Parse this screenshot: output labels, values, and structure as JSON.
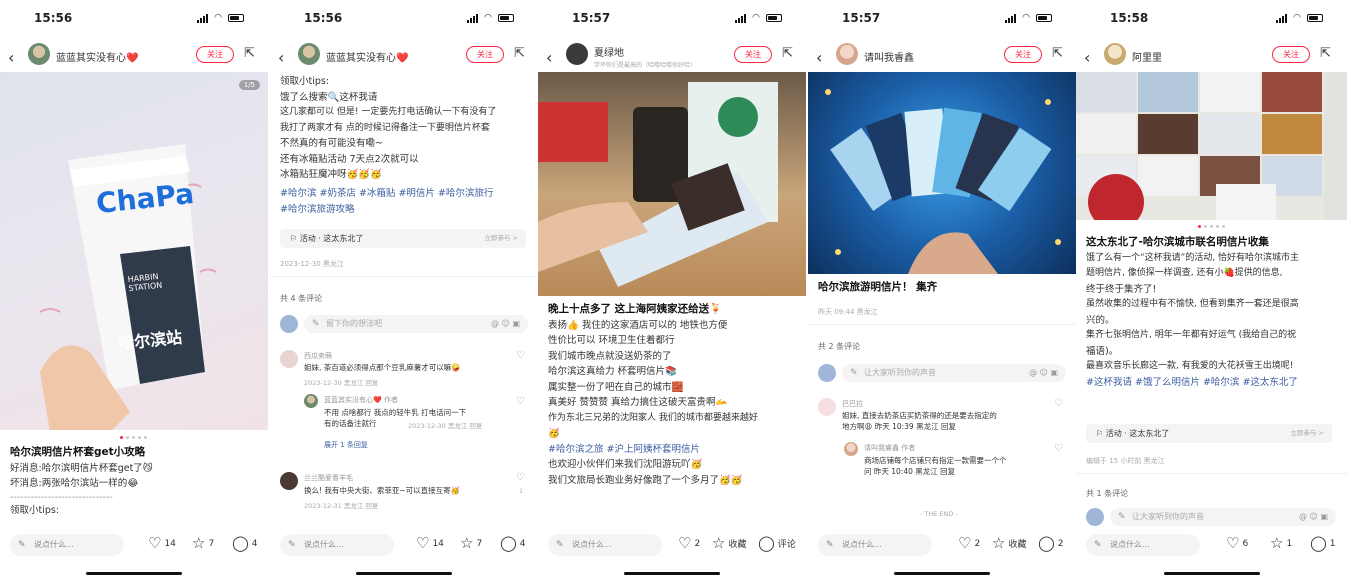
{
  "screens": [
    {
      "time": "15:56",
      "author": "蓝蓝其实没有心❤️",
      "follow": "关注",
      "image_counter": "1/5",
      "cup_brand": "ChaPa",
      "cup_station": "HARBIN STATION",
      "cup_cn": "哈尔滨站",
      "title": "哈尔滨明信片杯套get小攻略",
      "lines": [
        "好消息:哈尔滨明信片杯套get了😼",
        "坏消息:两张哈尔滨站一样的😂",
        "------------------------------",
        "领取小tips:"
      ],
      "comment_placeholder": "说点什么...",
      "likes": "14",
      "collects": "7",
      "comments": "4"
    },
    {
      "time": "15:56",
      "author": "蓝蓝其实没有心❤️",
      "follow": "关注",
      "lines": [
        "领取小tips:",
        "饿了么搜索🔍这杯我请",
        "这几家都可以 但是! 一定要先打电话确认一下有没有了",
        "我打了两家才有  点的时候记得备注一下要明信片杯套",
        "不然真的有可能没有嘞~",
        "还有冰箱贴活动 7天点2次就可以",
        "冰箱贴狂魔冲呀🥳🥳🥳"
      ],
      "tags": [
        "#哈尔滨  #奶茶店  #冰箱贴  #明信片  #哈尔滨旅行",
        "#哈尔滨旅游攻略"
      ],
      "activity": "活动 · 这太东北了",
      "activity_go": "立即参与 >",
      "post_meta": "2023-12-30 黑龙江",
      "comment_count": "共 4 条评论",
      "comment_input": "留下你的想法吧",
      "comments_list": [
        {
          "name": "西瓜卖萌",
          "body": "姐妹, 茶百道必须得点那个豆乳麻薯才可以嘛🤪",
          "meta": "2023-12-30 黑龙江  回复"
        },
        {
          "name": "蓝蓝其实没有心❤️  作者",
          "body": "不用 点啥都行 我点的轻牛乳 打电话问一下",
          "body2": "有的话备注就行",
          "meta": "2023-12-30 黑龙江  回复"
        },
        {
          "name": "兰兰酷爱看羊毛",
          "body": "换么! 我有中央大街、索菲亚~可以直接互寄🥳",
          "meta": "2023-12-31 黑龙江  回复"
        }
      ],
      "expand": "展开 1 条回复",
      "like_small": "1",
      "likes": "14",
      "collects": "7",
      "comments": "4",
      "comment_placeholder": "说点什么..."
    },
    {
      "time": "15:57",
      "author": "夏绿地",
      "author_sub": "学坏你们是最高的（哈喽哈喽你好哈）",
      "follow": "关注",
      "title": "晚上十点多了 这上海阿姨家还给送🍹",
      "lines": [
        "表扬👍 我住的这家酒店可以的 地铁也方便",
        "性价比可以  环境卫生住着都行",
        "",
        "我们城市晚点就没送奶茶的了",
        "哈尔滨这真给力  杯套明信片📚",
        "属实整一份了吧在自己的城市🧱",
        "真美好  赞赞赞  真给力搞住这破天富贵啊🫴",
        "作为东北三兄弟的沈阳家人  我们的城市都要越来越好",
        "🥳"
      ],
      "tags": [
        "#哈尔滨之旅  #沪上阿姨杯套明信片"
      ],
      "lines2": [
        "也欢迎小伙伴们来我们沈阳游玩吖🥳",
        "我们文旅局长跑业务好像跑了一个多月了🥳🥳"
      ],
      "likes": "2",
      "collects": "收藏",
      "comments": "评论",
      "comment_placeholder": "说点什么..."
    },
    {
      "time": "15:57",
      "author": "请叫我睿鑫",
      "follow": "关注",
      "title": "哈尔滨旅游明信片！ 集齐",
      "post_meta": "昨天 09:44 黑龙江",
      "comment_count": "共 2 条评论",
      "comment_input": "让大家听到你的声音",
      "comments_list": [
        {
          "name": "巴巴拉",
          "body": "姐妹, 直接去奶茶店买奶茶得的还是要去指定的",
          "body2": "地方啊😩 昨天 10:39 黑龙江  回复"
        },
        {
          "name": "请叫我睿鑫  作者",
          "body": "商场店铺每个店铺只有指定一款需要一个个",
          "body2": "问  昨天 10:40 黑龙江  回复"
        }
      ],
      "end": "- THE END -",
      "likes": "2",
      "collects": "收藏",
      "comments": "2",
      "comment_placeholder": "说点什么..."
    },
    {
      "time": "15:58",
      "author": "阿里里",
      "follow": "关注",
      "title": "这太东北了-哈尔滨城市联名明信片收集",
      "lines": [
        "饿了么有一个“这杯我请”的活动, 恰好有哈尔滨城市主",
        "题明信片, 像侦探一样调查, 还有小🍓提供的信息,",
        "终于终于集齐了!",
        "虽然收集的过程中有不愉快, 但看到集齐一套还是很高",
        "兴的。",
        "集齐七张明信片, 明年一年都有好运气 (我给自己的祝",
        "福语)。",
        "",
        "最喜欢音乐长廊这一款, 有我爱的大花袄雪王出境呢!"
      ],
      "tags": [
        "#这杯我请  #饿了么明信片  #哈尔滨  #这太东北了"
      ],
      "activity": "活动 · 这太东北了",
      "activity_go": "立即参与 >",
      "post_meta": "编辑于 15 小时前 黑龙江",
      "comment_count": "共 1 条评论",
      "comment_input": "让大家听到你的声音",
      "likes": "6",
      "collects": "1",
      "comments": "1",
      "comment_placeholder": "说点什么..."
    }
  ]
}
